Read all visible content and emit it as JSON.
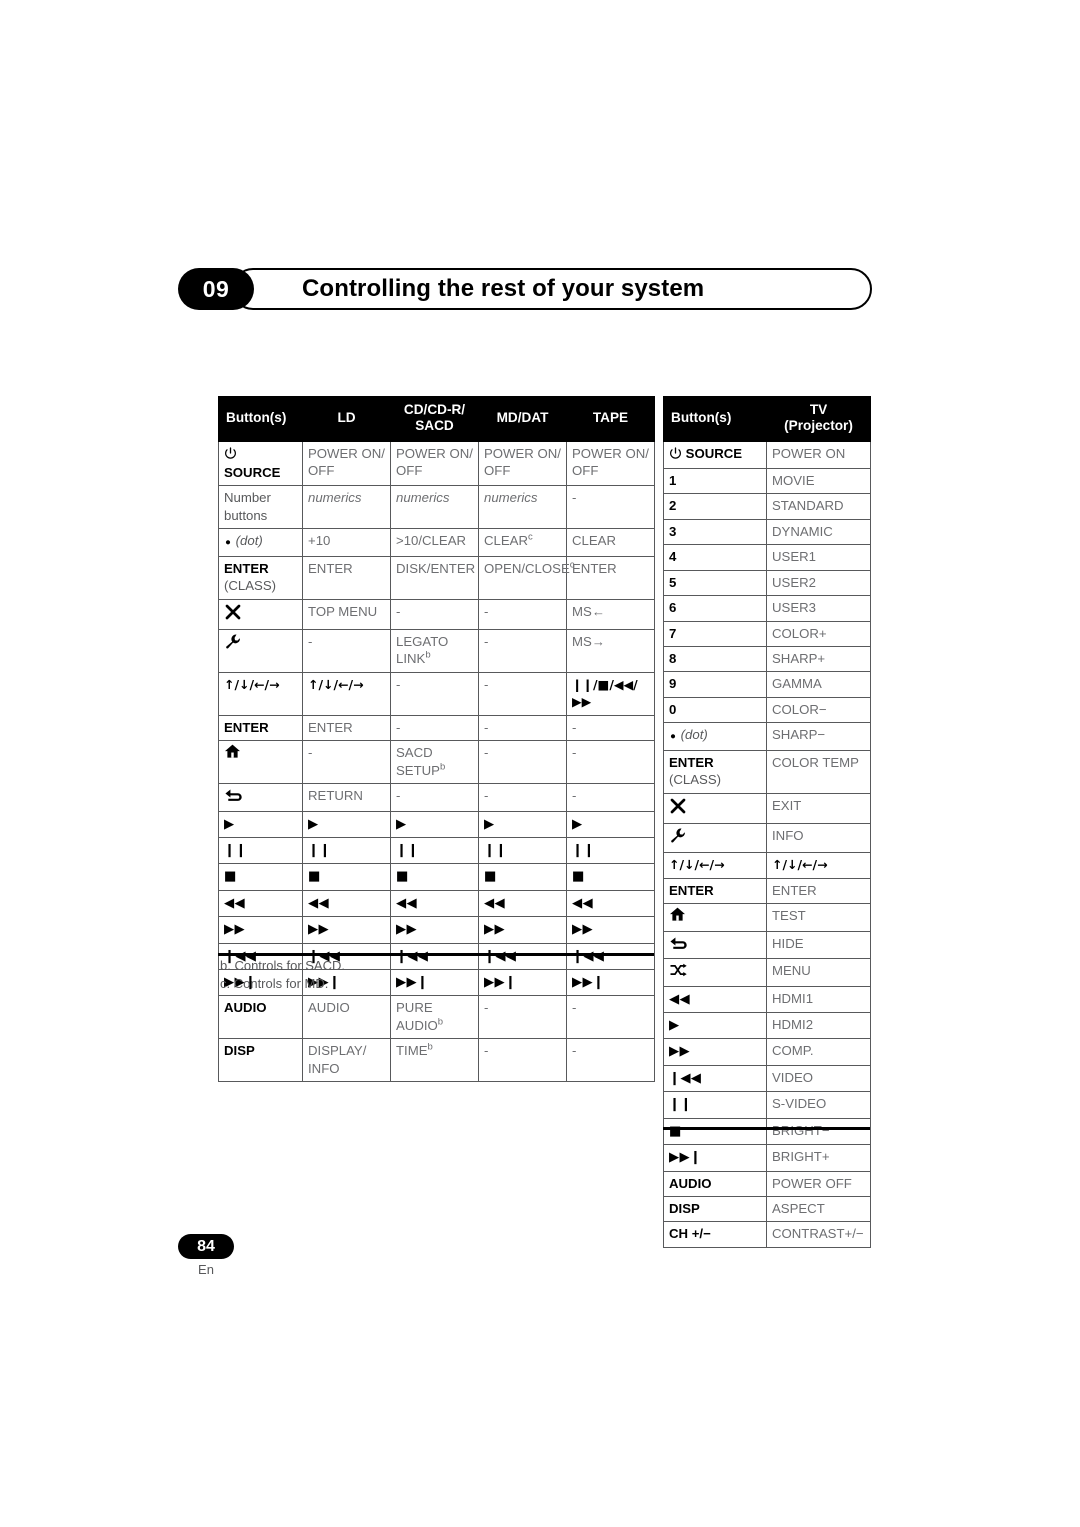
{
  "header": {
    "chapter_number": "09",
    "title": "Controlling the rest of your system"
  },
  "left_table": {
    "columns": [
      "Button(s)",
      "LD",
      "CD/CD-R/ SACD",
      "MD/DAT",
      "TAPE"
    ],
    "col_headers": [
      {
        "label": "Button(s)"
      },
      {
        "label": "LD"
      },
      {
        "label_line1": "CD/CD-R/",
        "label_line2": "SACD"
      },
      {
        "label": "MD/DAT"
      },
      {
        "label": "TAPE"
      }
    ],
    "rows": [
      {
        "button": "SOURCE",
        "button_icon": "power-icon",
        "ld": "POWER ON/ OFF",
        "cd": "POWER ON/ OFF",
        "md": "POWER ON/ OFF",
        "tape": "POWER ON/ OFF"
      },
      {
        "button": "Number buttons",
        "button_style": "plain",
        "ld": "numerics",
        "ld_italic": true,
        "cd": "numerics",
        "cd_italic": true,
        "md": "numerics",
        "md_italic": true,
        "tape": "-"
      },
      {
        "button": "(dot)",
        "button_icon": "dot-icon",
        "button_italic": true,
        "ld": "+10",
        "cd": ">10/CLEAR",
        "md": "CLEAR",
        "md_sup": "c",
        "tape": "CLEAR"
      },
      {
        "button": "ENTER",
        "button_sub": "(CLASS)",
        "ld": "ENTER",
        "cd": "DISK/ENTER",
        "md": "OPEN/CLOSE",
        "md_sup": "c",
        "tape": "ENTER"
      },
      {
        "button": "",
        "button_icon": "x-mark-icon",
        "ld": "TOP MENU",
        "cd": "-",
        "md": "-",
        "tape": "MS←"
      },
      {
        "button": "",
        "button_icon": "wrench-icon",
        "ld": "-",
        "cd": "LEGATO LINK",
        "cd_sup": "b",
        "md": "-",
        "tape": "MS→"
      },
      {
        "button": "↑/↓/←/→",
        "button_symbol": true,
        "ld": "↑/↓/←/→",
        "ld_symbol": true,
        "cd": "-",
        "md": "-",
        "tape": "❙❙/■/◀◀/▶▶",
        "tape_symbol": true
      },
      {
        "button": "ENTER",
        "ld": "ENTER",
        "cd": "-",
        "md": "-",
        "tape": "-"
      },
      {
        "button": "",
        "button_icon": "home-icon",
        "ld": "-",
        "cd": "SACD SETUP",
        "cd_sup": "b",
        "md": "-",
        "tape": "-"
      },
      {
        "button": "",
        "button_icon": "return-icon",
        "ld": "RETURN",
        "cd": "-",
        "md": "-",
        "tape": "-"
      },
      {
        "button": "▶",
        "button_symbol": true,
        "ld": "▶",
        "ld_symbol": true,
        "cd": "▶",
        "cd_symbol": true,
        "md": "▶",
        "md_symbol": true,
        "tape": "▶",
        "tape_symbol": true
      },
      {
        "button": "❙❙",
        "button_symbol": true,
        "ld": "❙❙",
        "ld_symbol": true,
        "cd": "❙❙",
        "cd_symbol": true,
        "md": "❙❙",
        "md_symbol": true,
        "tape": "❙❙",
        "tape_symbol": true
      },
      {
        "button": "■",
        "button_symbol": true,
        "ld": "■",
        "ld_symbol": true,
        "cd": "■",
        "cd_symbol": true,
        "md": "■",
        "md_symbol": true,
        "tape": "■",
        "tape_symbol": true
      },
      {
        "button": "◀◀",
        "button_symbol": true,
        "ld": "◀◀",
        "ld_symbol": true,
        "cd": "◀◀",
        "cd_symbol": true,
        "md": "◀◀",
        "md_symbol": true,
        "tape": "◀◀",
        "tape_symbol": true
      },
      {
        "button": "▶▶",
        "button_symbol": true,
        "ld": "▶▶",
        "ld_symbol": true,
        "cd": "▶▶",
        "cd_symbol": true,
        "md": "▶▶",
        "md_symbol": true,
        "tape": "▶▶",
        "tape_symbol": true
      },
      {
        "button": "❙◀◀",
        "button_symbol": true,
        "ld": "❙◀◀",
        "ld_symbol": true,
        "cd": "❙◀◀",
        "cd_symbol": true,
        "md": "❙◀◀",
        "md_symbol": true,
        "tape": "❙◀◀",
        "tape_symbol": true
      },
      {
        "button": "▶▶❙",
        "button_symbol": true,
        "ld": "▶▶❙",
        "ld_symbol": true,
        "cd": "▶▶❙",
        "cd_symbol": true,
        "md": "▶▶❙",
        "md_symbol": true,
        "tape": "▶▶❙",
        "tape_symbol": true
      },
      {
        "button": "AUDIO",
        "ld": "AUDIO",
        "cd": "PURE AUDIO",
        "cd_sup": "b",
        "md": "-",
        "tape": "-"
      },
      {
        "button": "DISP",
        "ld": "DISPLAY/ INFO",
        "cd": "TIME",
        "cd_sup": "b",
        "md": "-",
        "tape": "-"
      }
    ]
  },
  "right_table": {
    "col_headers": [
      {
        "label": "Button(s)"
      },
      {
        "label_line1": "TV",
        "label_line2": "(Projector)"
      }
    ],
    "rows": [
      {
        "button": "SOURCE",
        "button_icon": "power-icon",
        "tv": "POWER ON"
      },
      {
        "button": "1",
        "tv": "MOVIE"
      },
      {
        "button": "2",
        "tv": "STANDARD"
      },
      {
        "button": "3",
        "tv": "DYNAMIC"
      },
      {
        "button": "4",
        "tv": "USER1"
      },
      {
        "button": "5",
        "tv": "USER2"
      },
      {
        "button": "6",
        "tv": "USER3"
      },
      {
        "button": "7",
        "tv": "COLOR+"
      },
      {
        "button": "8",
        "tv": "SHARP+"
      },
      {
        "button": "9",
        "tv": "GAMMA"
      },
      {
        "button": "0",
        "tv": "COLOR−"
      },
      {
        "button": "(dot)",
        "button_icon": "dot-icon",
        "button_italic": true,
        "tv": "SHARP−"
      },
      {
        "button": "ENTER",
        "button_sub_inline": "(CLASS)",
        "tv": "COLOR TEMP"
      },
      {
        "button": "",
        "button_icon": "x-mark-icon",
        "tv": "EXIT"
      },
      {
        "button": "",
        "button_icon": "wrench-icon",
        "tv": "INFO"
      },
      {
        "button": "↑/↓/←/→",
        "button_symbol": true,
        "tv": "↑/↓/←/→",
        "tv_symbol": true
      },
      {
        "button": "ENTER",
        "tv": "ENTER"
      },
      {
        "button": "",
        "button_icon": "home-icon",
        "tv": "TEST"
      },
      {
        "button": "",
        "button_icon": "return-icon",
        "tv": "HIDE"
      },
      {
        "button": "",
        "button_icon": "shuffle-icon",
        "tv": "MENU"
      },
      {
        "button": "◀◀",
        "button_symbol": true,
        "tv": "HDMI1"
      },
      {
        "button": "▶",
        "button_symbol": true,
        "tv": "HDMI2"
      },
      {
        "button": "▶▶",
        "button_symbol": true,
        "tv": "COMP."
      },
      {
        "button": "❙◀◀",
        "button_symbol": true,
        "tv": "VIDEO"
      },
      {
        "button": "❙❙",
        "button_symbol": true,
        "tv": "S-VIDEO"
      },
      {
        "button": "■",
        "button_symbol": true,
        "tv": "BRIGHT−"
      },
      {
        "button": "▶▶❙",
        "button_symbol": true,
        "tv": "BRIGHT+"
      },
      {
        "button": "AUDIO",
        "tv": "POWER OFF"
      },
      {
        "button": "DISP",
        "tv": "ASPECT"
      },
      {
        "button": "CH +/−",
        "tv": "CONTRAST+/−"
      }
    ]
  },
  "footnotes": [
    "b. Controls for SACD.",
    "c. Controls for MD."
  ],
  "footer": {
    "page_number": "84",
    "locale": "En"
  }
}
